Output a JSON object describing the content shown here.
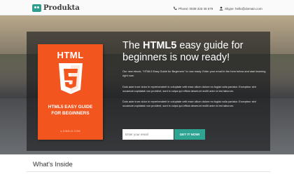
{
  "header": {
    "logo_text": "Produkta",
    "phone": "Phone: 0039 333 45 679",
    "skype": "Skype: hello@domain.com",
    "phone_icon": "phone-icon",
    "skype_icon": "user-icon"
  },
  "hero": {
    "headline_pre": "The ",
    "headline_bold": "HTML5",
    "headline_post": " easy guide for beginners is now ready!",
    "paragraph1": "Our new ebook, \"HTML5 Easy Guide for Beginners\" is now ready. Enter your email in the form below and start learning right now.",
    "paragraph2": "Duis aute irure dolor in reprehenderit in voluptate velit esse cillum dolore eu fugiat nulla pariatur. Excepteur sint occaecat cupidatat non proident, sunt in culpa qui officia deserunt mollit anim id est laborum.",
    "paragraph3": "Duis aute irure dolor in reprehenderit in voluptate velit esse cillum dolore eu fugiat nulla pariatur. Excepteur sint occaecat cupidatat non proident, sunt in culpa qui officia deserunt mollit anim id est laborum.",
    "email_placeholder": "Enter your email",
    "cta_label": "GET IT NOW!"
  },
  "book": {
    "top_label": "HTML",
    "shield_number": "5",
    "title_line1": "HTML5 EASY GUIDE",
    "title_line2": "FOR BEGINNERS",
    "brand": "● KINDLE.COM"
  },
  "section": {
    "title": "What's Inside"
  },
  "colors": {
    "accent": "#2ea492",
    "cover": "#f2551e"
  }
}
